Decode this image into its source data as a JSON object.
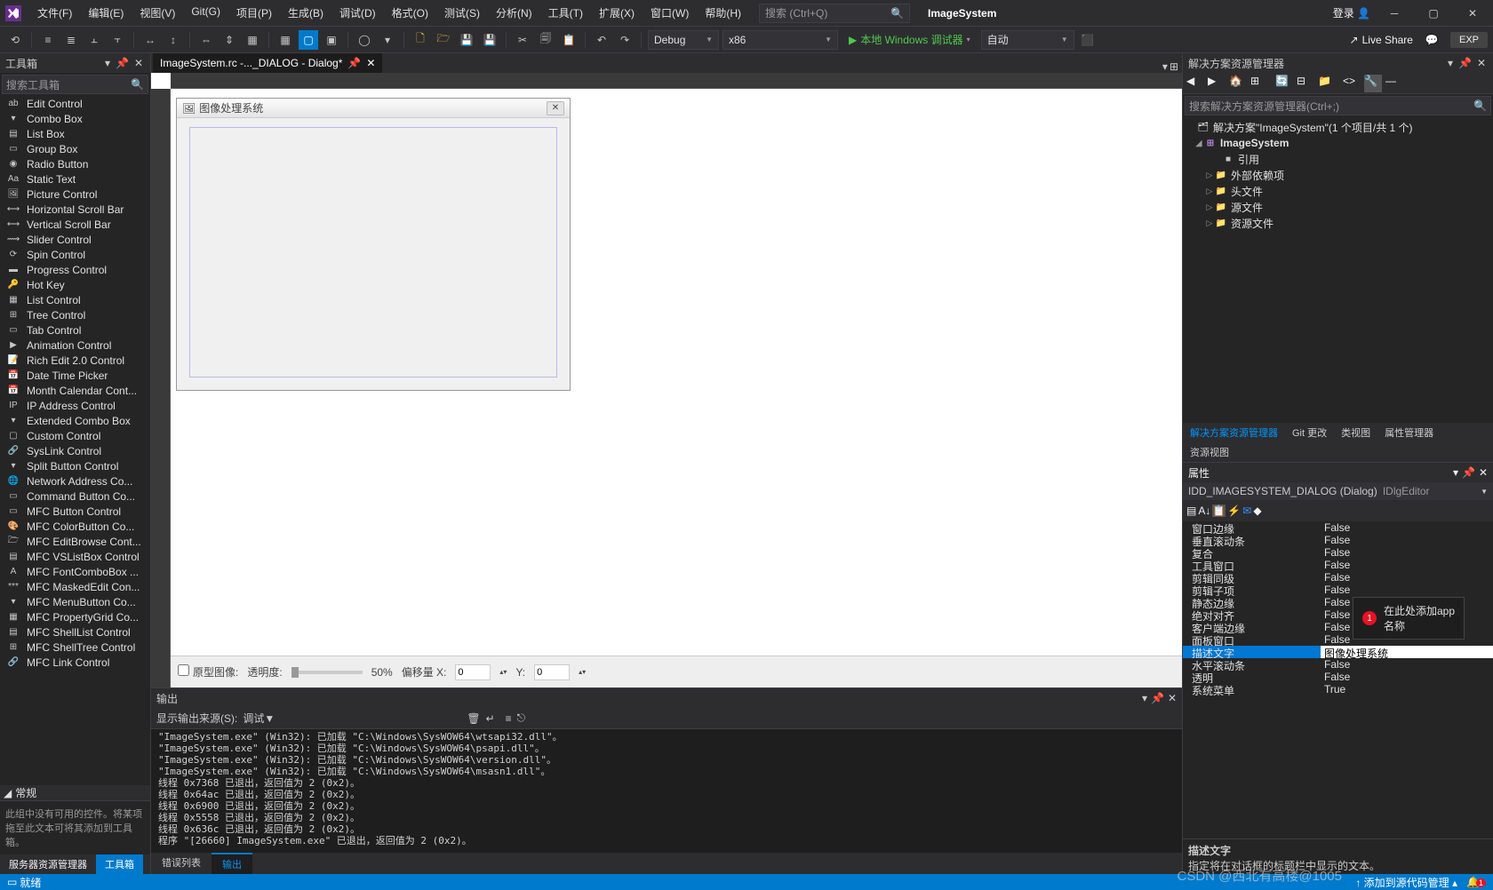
{
  "title": {
    "app_name": "ImageSystem",
    "login": "登录",
    "exp": "EXP"
  },
  "menu": [
    "文件(F)",
    "编辑(E)",
    "视图(V)",
    "Git(G)",
    "项目(P)",
    "生成(B)",
    "调试(D)",
    "格式(O)",
    "测试(S)",
    "分析(N)",
    "工具(T)",
    "扩展(X)",
    "窗口(W)",
    "帮助(H)"
  ],
  "search_placeholder": "搜索 (Ctrl+Q)",
  "toolbar": {
    "config": "Debug",
    "platform": "x86",
    "run": "本地 Windows 调试器",
    "auto": "自动",
    "live_share": "Live Share"
  },
  "toolbox": {
    "title": "工具箱",
    "search_placeholder": "搜索工具箱",
    "group": "常规",
    "footer": "此组中没有可用的控件。将某项拖至此文本可将其添加到工具箱。",
    "items": [
      "Edit Control",
      "Combo Box",
      "List Box",
      "Group Box",
      "Radio Button",
      "Static Text",
      "Picture Control",
      "Horizontal Scroll Bar",
      "Vertical Scroll Bar",
      "Slider Control",
      "Spin Control",
      "Progress Control",
      "Hot Key",
      "List Control",
      "Tree Control",
      "Tab Control",
      "Animation Control",
      "Rich Edit 2.0 Control",
      "Date Time Picker",
      "Month Calendar Cont...",
      "IP Address Control",
      "Extended Combo Box",
      "Custom Control",
      "SysLink Control",
      "Split Button Control",
      "Network Address Co...",
      "Command Button Co...",
      "MFC Button Control",
      "MFC ColorButton Co...",
      "MFC EditBrowse Cont...",
      "MFC VSListBox Control",
      "MFC FontComboBox ...",
      "MFC MaskedEdit Con...",
      "MFC MenuButton Co...",
      "MFC PropertyGrid Co...",
      "MFC ShellList Control",
      "MFC ShellTree Control",
      "MFC Link Control"
    ],
    "bottom_tabs": {
      "server": "服务器资源管理器",
      "toolbox": "工具箱"
    }
  },
  "doc_tab": "ImageSystem.rc -..._DIALOG - Dialog*",
  "dialog": {
    "caption": "图像处理系统"
  },
  "designer_footer": {
    "prototype": "原型图像:",
    "opacity": "透明度:",
    "opacity_val": "50%",
    "offset": "偏移量 X:",
    "offset_x": "0",
    "offset_y_lbl": "Y:",
    "offset_y": "0"
  },
  "output": {
    "title": "输出",
    "source_lbl": "显示输出来源(S):",
    "source": "调试",
    "lines": [
      "\"ImageSystem.exe\" (Win32): 已加载 \"C:\\Windows\\SysWOW64\\wtsapi32.dll\"。",
      "\"ImageSystem.exe\" (Win32): 已加载 \"C:\\Windows\\SysWOW64\\psapi.dll\"。",
      "\"ImageSystem.exe\" (Win32): 已加载 \"C:\\Windows\\SysWOW64\\version.dll\"。",
      "\"ImageSystem.exe\" (Win32): 已加载 \"C:\\Windows\\SysWOW64\\msasn1.dll\"。",
      "线程 0x7368 已退出，返回值为 2 (0x2)。",
      "线程 0x64ac 已退出，返回值为 2 (0x2)。",
      "线程 0x6900 已退出，返回值为 2 (0x2)。",
      "线程 0x5558 已退出，返回值为 2 (0x2)。",
      "线程 0x636c 已退出，返回值为 2 (0x2)。",
      "程序 \"[26660] ImageSystem.exe\" 已退出，返回值为 2 (0x2)。"
    ],
    "tabs": {
      "errors": "错误列表",
      "output": "输出"
    }
  },
  "solution": {
    "title": "解决方案资源管理器",
    "search_placeholder": "搜索解决方案资源管理器(Ctrl+;)",
    "root": "解决方案\"ImageSystem\"(1 个项目/共 1 个)",
    "project": "ImageSystem",
    "nodes": [
      "引用",
      "外部依赖项",
      "头文件",
      "源文件",
      "资源文件"
    ],
    "tabs": [
      "解决方案资源管理器",
      "Git 更改",
      "类视图",
      "属性管理器",
      "资源视图"
    ]
  },
  "properties": {
    "title": "属性",
    "object": "IDD_IMAGESYSTEM_DIALOG (Dialog)",
    "editor": "IDlgEditor",
    "rows": [
      {
        "n": "窗口边缘",
        "v": "False"
      },
      {
        "n": "垂直滚动条",
        "v": "False"
      },
      {
        "n": "复合",
        "v": "False"
      },
      {
        "n": "工具窗口",
        "v": "False"
      },
      {
        "n": "剪辑同级",
        "v": "False"
      },
      {
        "n": "剪辑子项",
        "v": "False"
      },
      {
        "n": "静态边缘",
        "v": "False"
      },
      {
        "n": "绝对对齐",
        "v": "False"
      },
      {
        "n": "客户端边缘",
        "v": "False"
      },
      {
        "n": "面板窗口",
        "v": "False"
      },
      {
        "n": "描述文字",
        "v": "图像处理系统",
        "selected": true
      },
      {
        "n": "水平滚动条",
        "v": "False"
      },
      {
        "n": "透明",
        "v": "False"
      },
      {
        "n": "系统菜单",
        "v": "True"
      }
    ],
    "desc_title": "描述文字",
    "desc_body": "指定将在对话框的标题栏中显示的文本。"
  },
  "tooltip": {
    "badge": "1",
    "text": "在此处添加app\n名称"
  },
  "status": "就绪",
  "status_right": "添加到源代码管理",
  "watermark": "CSDN @西北有高楼@1005"
}
